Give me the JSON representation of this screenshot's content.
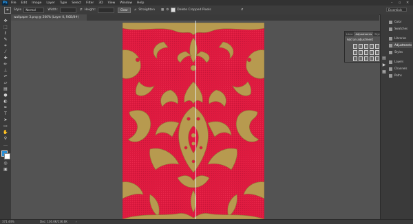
{
  "menubar": {
    "logo": "Ps",
    "items": [
      "File",
      "Edit",
      "Image",
      "Layer",
      "Type",
      "Select",
      "Filter",
      "3D",
      "View",
      "Window",
      "Help"
    ]
  },
  "options": {
    "tool_icon": "move-tool-icon",
    "mode_label": "Style",
    "mode_value": "Normal",
    "width_label": "Width:",
    "height_label": "Height:",
    "straighten_label": "Straighten",
    "delete_cropped_label": "Delete Cropped Pixels",
    "workspace_value": "Essentials"
  },
  "document": {
    "tab_title": "wallpaper 3.png @ 200% (Layer 0, RGB/8#)"
  },
  "canvas": {
    "background_color": "#de1a3f",
    "pattern_color": "#b79a4f"
  },
  "status": {
    "zoom": "371.44%",
    "doc": "Doc: 136.6K/136.6K"
  },
  "adjustments_panel": {
    "tabs": [
      "Libra",
      "Adjustments",
      "Styles"
    ],
    "add_label": "Add an adjustment"
  },
  "right_dock": {
    "items": [
      "Color",
      "Swatches",
      "Libraries",
      "Adjustments",
      "Styles",
      "Layers",
      "Channels",
      "Paths"
    ]
  }
}
